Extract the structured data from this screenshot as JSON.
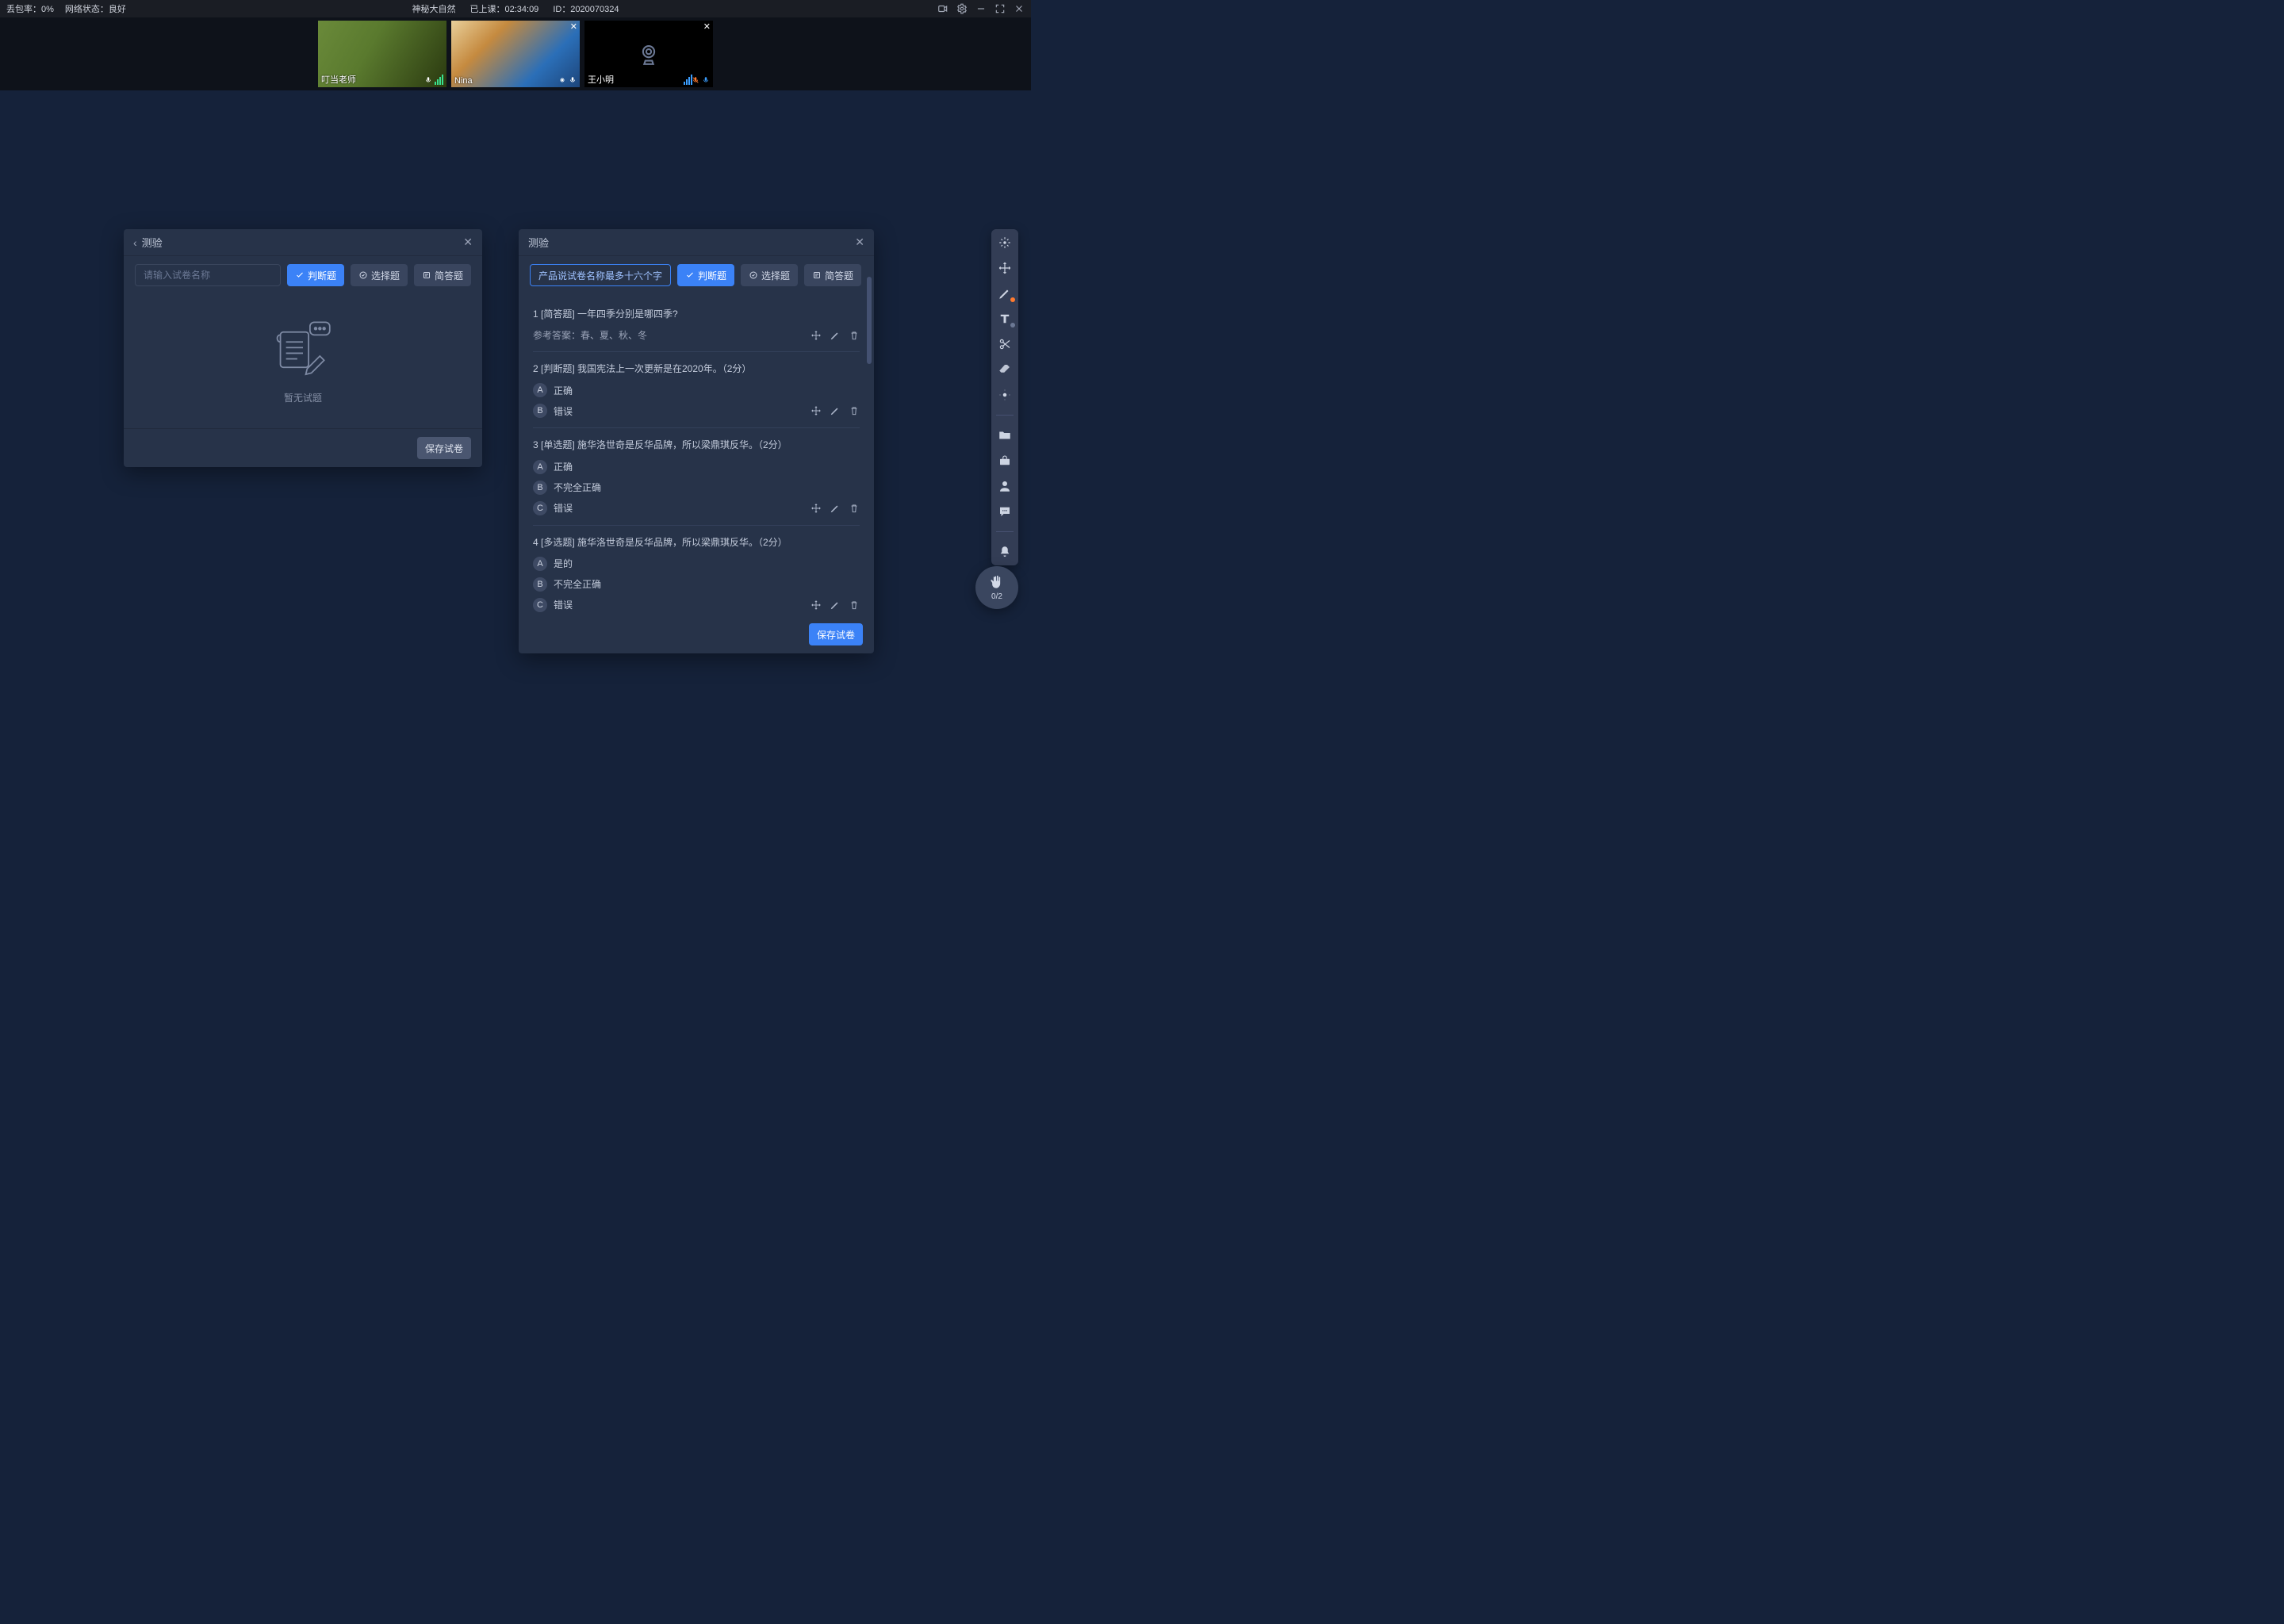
{
  "topbar": {
    "packet_loss": "丢包率：0%",
    "net_status": "网络状态：良好",
    "course_name": "神秘大自然",
    "elapsed_label": "已上课：02:34:09",
    "id_label": "ID：2020070324"
  },
  "videos": [
    {
      "name": "叮当老师",
      "mic": true,
      "signal": true,
      "camera": true,
      "closable": false
    },
    {
      "name": "Nina",
      "mic": true,
      "signal": true,
      "camera": true,
      "closable": true
    },
    {
      "name": "王小明",
      "mic": false,
      "mic_muted": true,
      "camera": false,
      "closable": true
    }
  ],
  "panel1": {
    "title": "测验",
    "placeholder": "请输入试卷名称",
    "btn_judge": "判断题",
    "btn_choice": "选择题",
    "btn_short": "简答题",
    "empty": "暂无试题",
    "save": "保存试卷"
  },
  "panel2": {
    "title": "测验",
    "name_value": "产品说试卷名称最多十六个字",
    "btn_judge": "判断题",
    "btn_choice": "选择题",
    "btn_short": "简答题",
    "save": "保存试卷",
    "questions": [
      {
        "num": "1",
        "tag": "[简答题]",
        "text": "一年四季分别是哪四季?",
        "answer_label": "参考答案：春、夏、秋、冬",
        "options": []
      },
      {
        "num": "2",
        "tag": "[判断题]",
        "text": "我国宪法上一次更新是在2020年。（2分）",
        "options": [
          {
            "k": "A",
            "t": "正确"
          },
          {
            "k": "B",
            "t": "错误"
          }
        ],
        "actions_on_last": true
      },
      {
        "num": "3",
        "tag": "[单选题]",
        "text": "施华洛世奇是反华品牌，所以梁鼎琪反华。（2分）",
        "options": [
          {
            "k": "A",
            "t": "正确"
          },
          {
            "k": "B",
            "t": "不完全正确"
          },
          {
            "k": "C",
            "t": "错误"
          }
        ],
        "actions_on_last": true
      },
      {
        "num": "4",
        "tag": "[多选题]",
        "text": "施华洛世奇是反华品牌，所以梁鼎琪反华。（2分）",
        "options": [
          {
            "k": "A",
            "t": "是的"
          },
          {
            "k": "B",
            "t": "不完全正确"
          },
          {
            "k": "C",
            "t": "错误"
          }
        ],
        "actions_on_last": true
      }
    ]
  },
  "toolbar": {
    "items": [
      "pointer",
      "move",
      "pen",
      "text",
      "scissors",
      "eraser",
      "highlight",
      "folder",
      "toolbox",
      "user",
      "chat",
      "bell"
    ]
  },
  "hand": {
    "count": "0/2"
  }
}
